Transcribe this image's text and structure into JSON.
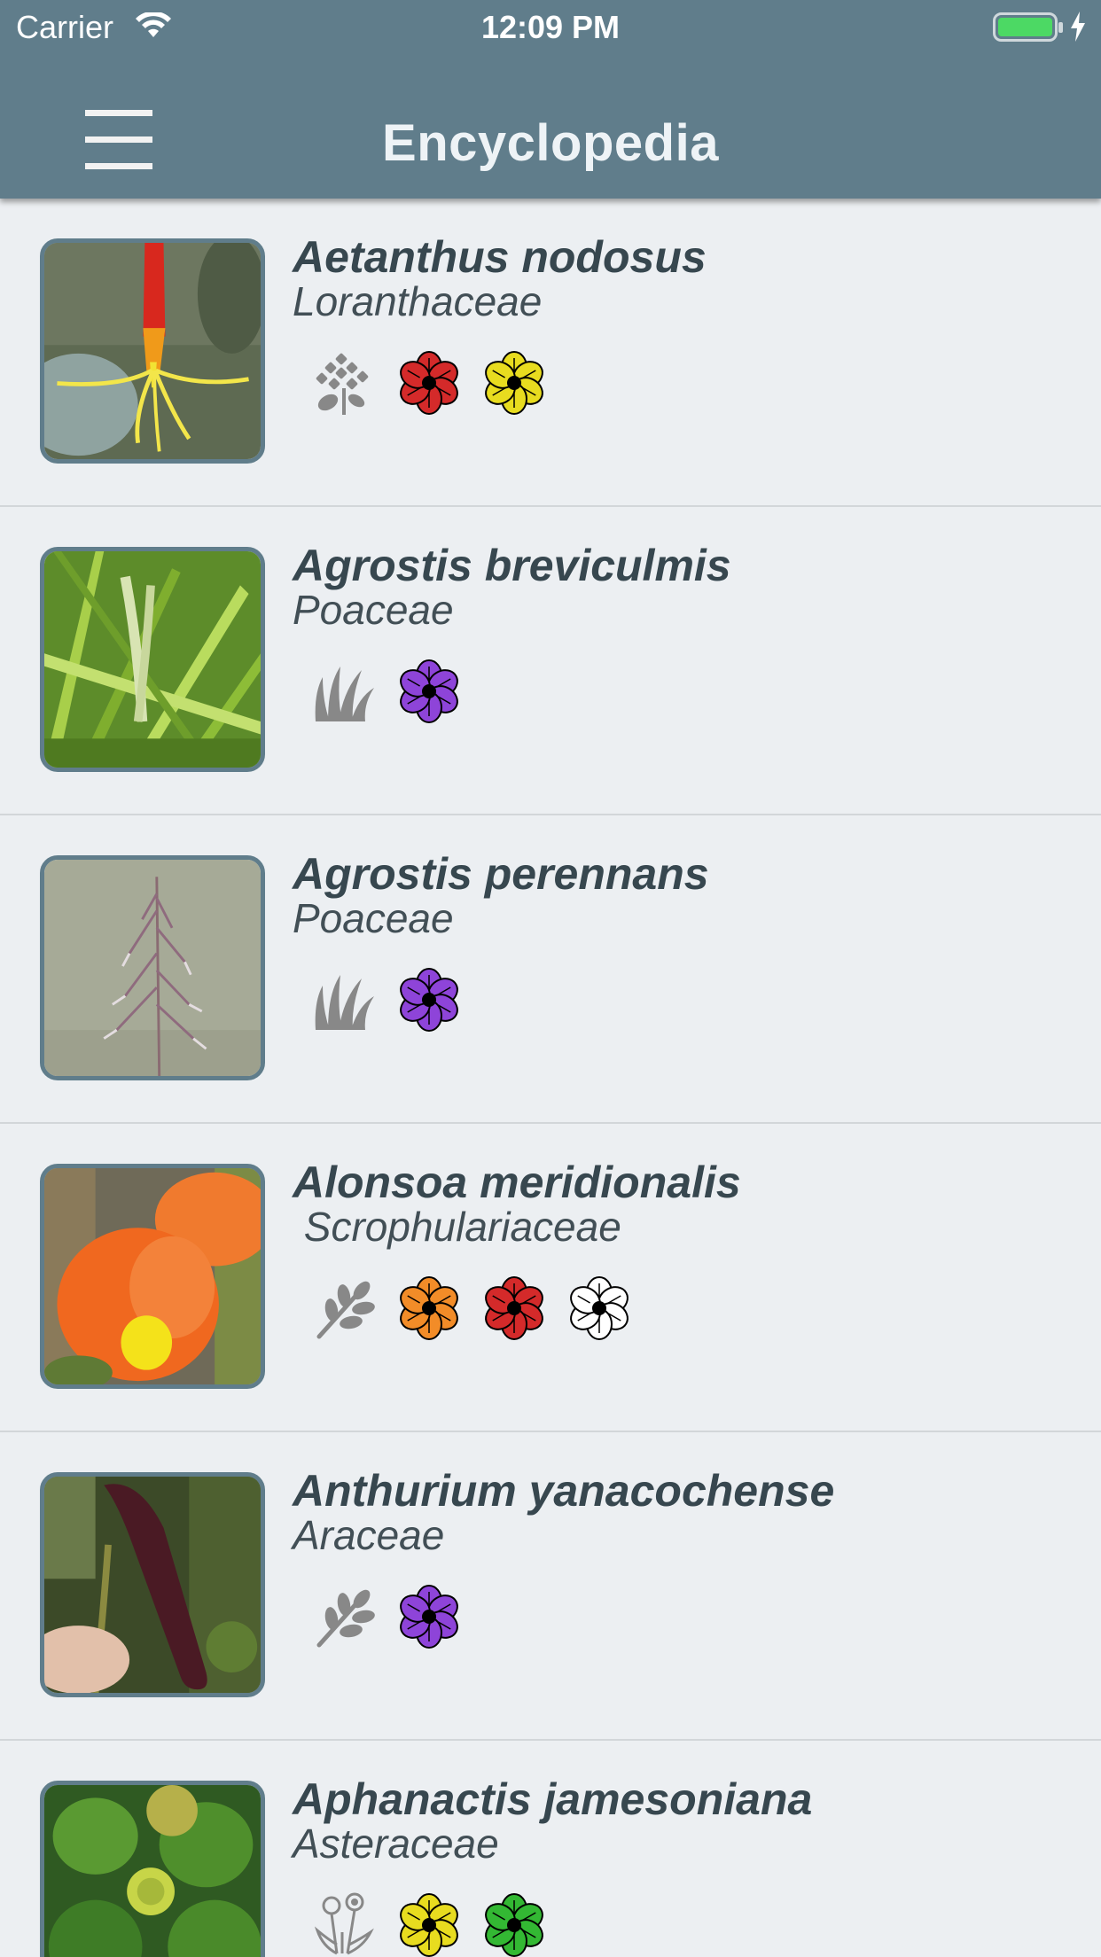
{
  "status_bar": {
    "carrier": "Carrier",
    "time": "12:09 PM",
    "battery_color": "#4cd964"
  },
  "nav": {
    "title": "Encyclopedia",
    "menu_icon": "hamburger-menu-icon",
    "bar_color": "#607d8b"
  },
  "plants": [
    {
      "species": "Aetanthus nodosus",
      "family": "Loranthaceae",
      "photo": "red-yellow-tubular-flower",
      "habit_icon": "hydrangea-cluster-icon",
      "flower_colors": [
        "#d42a2a",
        "#e8dc1f"
      ]
    },
    {
      "species": "Agrostis breviculmis",
      "family": "Poaceae",
      "photo": "green-grass-blades",
      "habit_icon": "grass-icon",
      "flower_colors": [
        "#8e44d9"
      ]
    },
    {
      "species": "Agrostis perennans",
      "family": "Poaceae",
      "photo": "grass-panicle-grey-background",
      "habit_icon": "grass-icon",
      "flower_colors": [
        "#8e44d9"
      ]
    },
    {
      "species": "Alonsoa meridionalis",
      "family": " Scrophulariaceae",
      "photo": "orange-snapdragon-flower",
      "habit_icon": "leafy-branch-icon",
      "flower_colors": [
        "#f28c28",
        "#d42a2a",
        "#ffffff"
      ]
    },
    {
      "species": "Anthurium yanacochense",
      "family": "Araceae",
      "photo": "dark-red-spadix",
      "habit_icon": "leafy-branch-icon",
      "flower_colors": [
        "#8e44d9"
      ]
    },
    {
      "species": "Aphanactis jamesoniana",
      "family": "Asteraceae",
      "photo": "green-rosette-yellow-center",
      "habit_icon": "dandelion-icon",
      "flower_colors": [
        "#e8dc1f",
        "#33b833"
      ]
    }
  ]
}
